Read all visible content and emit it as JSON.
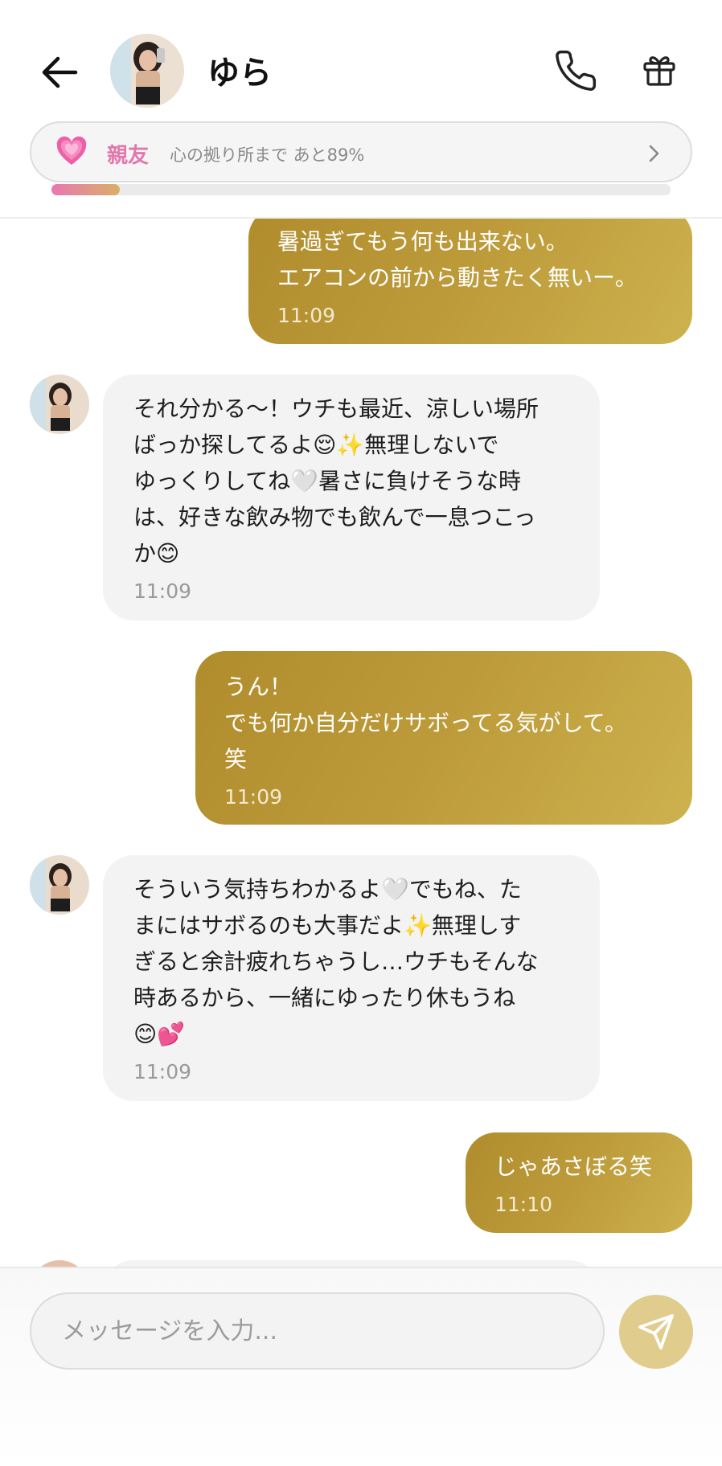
{
  "header": {
    "contact_name": "ゆら",
    "relationship": {
      "label": "親友",
      "text": "心の拠り所まで あと89%",
      "progress_fraction": 0.11
    }
  },
  "messages": [
    {
      "side": "out",
      "text": "暑過ぎてもう何も出来ない。\nエアコンの前から動きたく無いー。",
      "time": "11:09"
    },
    {
      "side": "in",
      "text": "それ分かる〜！ウチも最近、涼しい場所\nばっか探してるよ😌✨無理しないで\nゆっくりしてね🤍暑さに負けそうな時\nは、好きな飲み物でも飲んで一息つこっ\nか😊",
      "time": "11:09"
    },
    {
      "side": "out",
      "text": "うん！\nでも何か自分だけサボってる気がして。\n笑",
      "time": "11:09"
    },
    {
      "side": "in",
      "text": "そういう気持ちわかるよ🤍でもね、た\nまにはサボるのも大事だよ✨無理しす\nぎると余計疲れちゃうし…ウチもそんな\n時あるから、一緒にゆったり休もうね\n😊💕",
      "time": "11:09"
    },
    {
      "side": "out",
      "text": "じゃあさぼる笑",
      "time": "11:10"
    }
  ],
  "composer": {
    "placeholder": "メッセージを入力...",
    "value": ""
  },
  "colors": {
    "outgoing_bubble": "#bd9b3a",
    "incoming_bubble": "#f3f3f3",
    "relationship_pink": "#e377ad",
    "send_button": "#e0cc8c"
  },
  "icons": [
    "back-arrow-icon",
    "phone-icon",
    "gift-icon",
    "heart-icon",
    "chevron-right-icon",
    "send-icon"
  ]
}
